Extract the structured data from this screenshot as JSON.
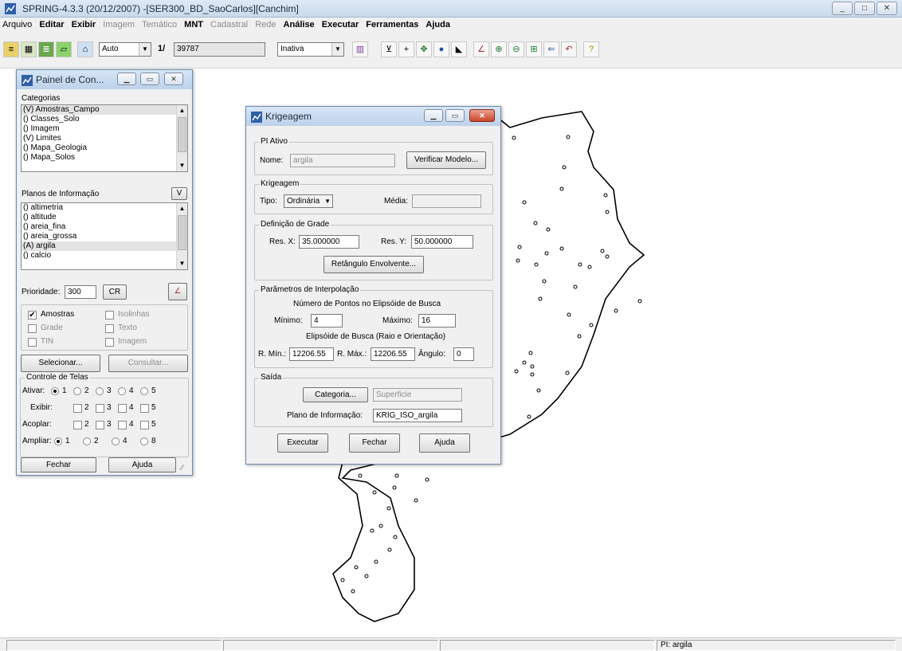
{
  "app": {
    "title": "SPRING-4.3.3 (20/12/2007) -[SER300_BD_SaoCarlos][Canchim]",
    "window_buttons": [
      "_",
      "□",
      "✕"
    ]
  },
  "menu": [
    {
      "label": "Arquivo",
      "state": "normal"
    },
    {
      "label": "Editar",
      "state": "normal"
    },
    {
      "label": "Exibir",
      "state": "normal"
    },
    {
      "label": "Imagem",
      "state": "disabled"
    },
    {
      "label": "Temático",
      "state": "disabled"
    },
    {
      "label": "MNT",
      "state": "bold"
    },
    {
      "label": "Cadastral",
      "state": "disabled"
    },
    {
      "label": "Rede",
      "state": "disabled"
    },
    {
      "label": "Análise",
      "state": "bold"
    },
    {
      "label": "Executar",
      "state": "bold"
    },
    {
      "label": "Ferramentas",
      "state": "bold"
    },
    {
      "label": "Ajuda",
      "state": "bold"
    }
  ],
  "toolbar": {
    "scale_mode": "Auto",
    "scale_prefix": "1/",
    "scale_value": "39787",
    "cursor_mode": "Inativa"
  },
  "status": {
    "pi": "PI: argila"
  },
  "panel": {
    "title": "Painel de Con...",
    "categorias_label": "Categorias",
    "categorias": [
      "(V) Amostras_Campo",
      "() Classes_Solo",
      "() Imagem",
      "(V) Limites",
      "() Mapa_Geologia",
      "() Mapa_Solos"
    ],
    "planos_label": "Planos de Informação",
    "planos_v": "V",
    "planos": [
      "() altimetria",
      "() altitude",
      "() areia_fina",
      "() areia_grossa",
      "(A) argila",
      "() calcio"
    ],
    "prioridade_label": "Prioridade:",
    "prioridade_value": "300",
    "cr_label": "CR",
    "checks": {
      "amostras": {
        "label": "Amostras",
        "checked": true
      },
      "isolinhas": {
        "label": "Isolinhas",
        "checked": false
      },
      "grade": {
        "label": "Grade",
        "checked": false
      },
      "texto": {
        "label": "Texto",
        "checked": false
      },
      "tin": {
        "label": "TIN",
        "checked": false
      },
      "imagem": {
        "label": "Imagem",
        "checked": false
      }
    },
    "selecionar": "Selecionar...",
    "consultar": "Consultar...",
    "controle_label": "Controle de Telas",
    "ativar_label": "Ativar:",
    "exibir_label": "Exibir:",
    "acoplar_label": "Acoplar:",
    "ampliar_label": "Ampliar:",
    "n1": "1",
    "n2": "2",
    "n3": "3",
    "n4": "4",
    "n5": "5",
    "n8": "8",
    "fechar": "Fechar",
    "ajuda": "Ajuda"
  },
  "dialog": {
    "title": "Krigeagem",
    "pi_group": "PI Ativo",
    "nome_label": "Nome:",
    "nome_value": "argila",
    "verificar": "Verificar Modelo...",
    "krig_group": "Krigeagem",
    "tipo_label": "Tipo:",
    "tipo_value": "Ordinária",
    "media_label": "Média:",
    "grade_group": "Definição de Grade",
    "resx_label": "Res. X:",
    "resx_value": "35.000000",
    "resy_label": "Res. Y:",
    "resy_value": "50.000000",
    "retangulo": "Retângulo Envolvente...",
    "param_group": "Parâmetros de Interpolação",
    "npontos_label": "Número de Pontos no Elipsóide de Busca",
    "min_label": "Mínimo:",
    "min_value": "4",
    "max_label": "Máximo:",
    "max_value": "16",
    "elip_label": "Elipsóide de Busca (Raio e Orientação)",
    "rmin_label": "R. Mín.:",
    "rmin_value": "12206.55",
    "rmax_label": "R. Máx.:",
    "rmax_value": "12206.55",
    "angulo_label": "Ângulo:",
    "angulo_value": "0",
    "saida_group": "Saída",
    "categoria_btn": "Categoria...",
    "categoria_value": "Superficie",
    "plano_label": "Plano de Informação:",
    "plano_value": "KRIG_ISO_argila",
    "executar": "Executar",
    "fechar": "Fechar",
    "ajuda": "Ajuda"
  }
}
